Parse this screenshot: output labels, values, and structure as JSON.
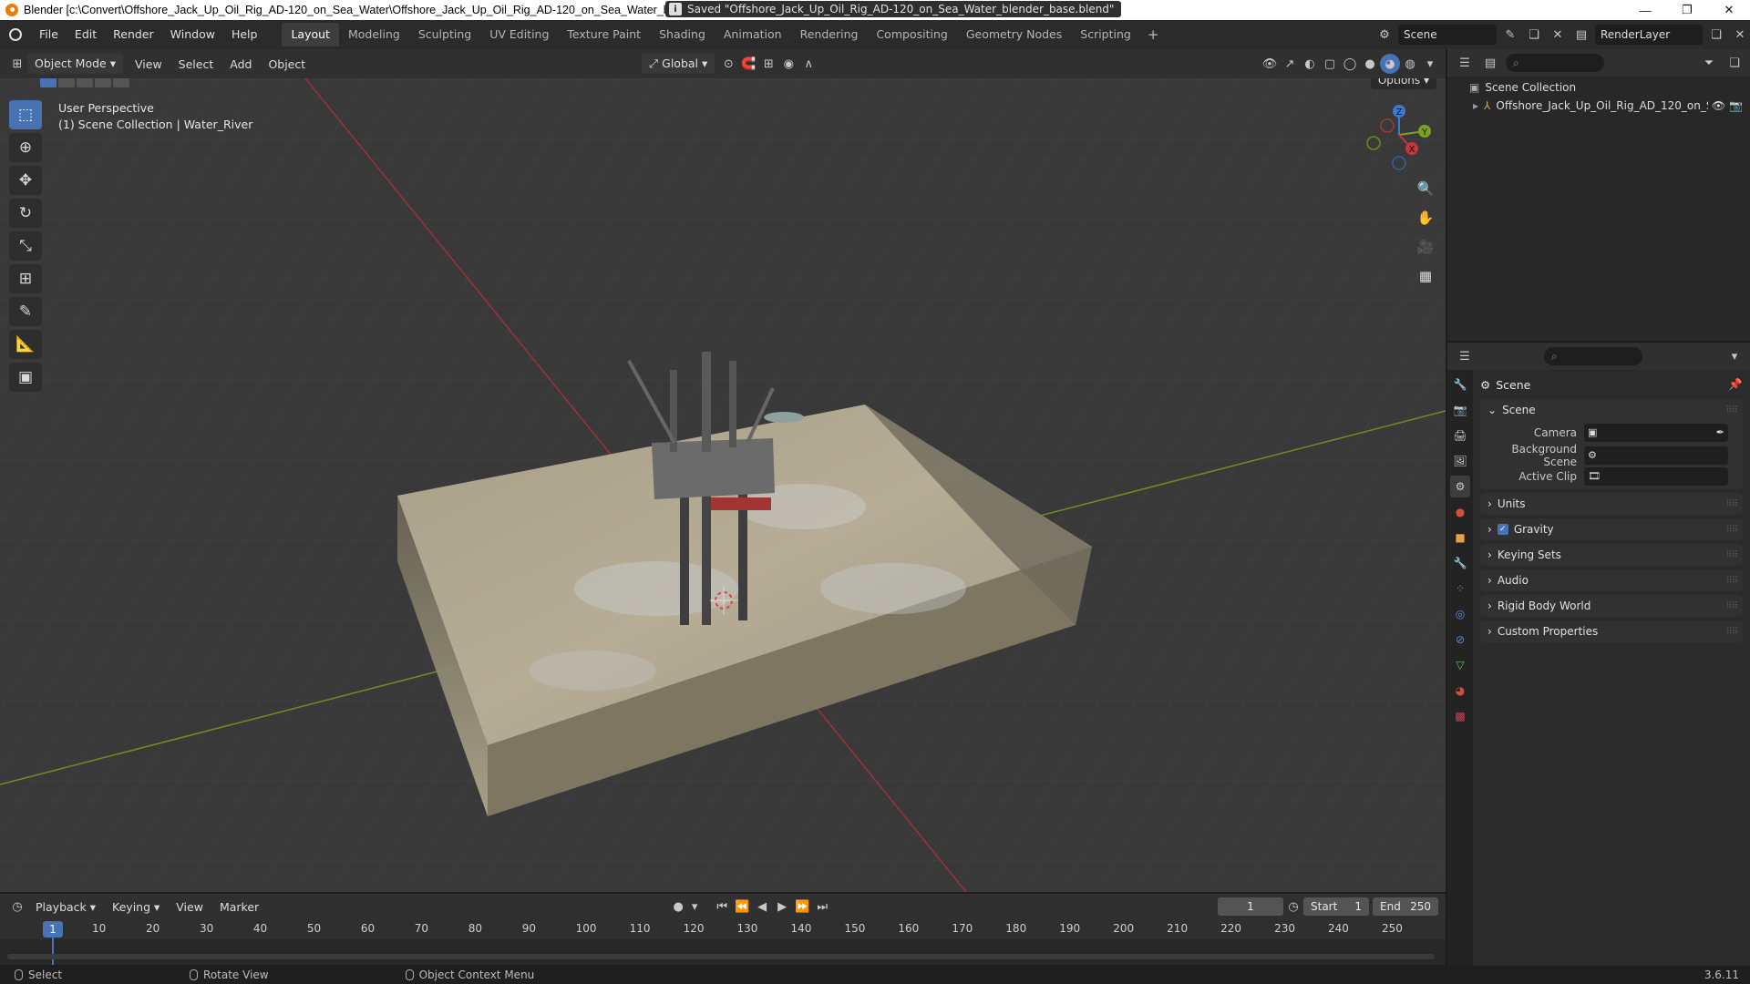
{
  "window": {
    "title": "Blender [c:\\Convert\\Offshore_Jack_Up_Oil_Rig_AD-120_on_Sea_Water\\Offshore_Jack_Up_Oil_Rig_AD-120_on_Sea_Water_blender_base.blend]",
    "minimize": "—",
    "maximize": "❐",
    "close": "✕"
  },
  "menu": {
    "items": [
      "File",
      "Edit",
      "Render",
      "Window",
      "Help"
    ],
    "workspaces": [
      "Layout",
      "Modeling",
      "Sculpting",
      "UV Editing",
      "Texture Paint",
      "Shading",
      "Animation",
      "Rendering",
      "Compositing",
      "Geometry Nodes",
      "Scripting"
    ],
    "active_workspace": "Layout",
    "add_tab": "+"
  },
  "topright": {
    "scene": "Scene",
    "render_layer": "RenderLayer"
  },
  "viewport_header": {
    "mode": "Object Mode",
    "menus": [
      "View",
      "Select",
      "Add",
      "Object"
    ],
    "transform_orientation": "Global",
    "options": "Options"
  },
  "viewport": {
    "perspective": "User Perspective",
    "collection_info": "(1) Scene Collection | Water_River",
    "gizmo": {
      "x": "X",
      "y": "Y",
      "z": "Z"
    }
  },
  "outliner": {
    "root": "Scene Collection",
    "items": [
      {
        "label": "Offshore_Jack_Up_Oil_Rig_AD_120_on_S"
      }
    ]
  },
  "properties": {
    "title": "Scene",
    "section": "Scene",
    "rows": [
      {
        "label": "Camera"
      },
      {
        "label": "Background Scene"
      },
      {
        "label": "Active Clip"
      }
    ],
    "panels": [
      "Units",
      "Gravity",
      "Keying Sets",
      "Audio",
      "Rigid Body World",
      "Custom Properties"
    ],
    "gravity_checked": true
  },
  "timeline": {
    "menus": [
      "Playback",
      "Keying",
      "View",
      "Marker"
    ],
    "current_frame": "1",
    "start_label": "Start",
    "start": "1",
    "end_label": "End",
    "end": "250",
    "ticks": [
      "1",
      "10",
      "20",
      "30",
      "40",
      "50",
      "60",
      "70",
      "80",
      "90",
      "100",
      "110",
      "120",
      "130",
      "140",
      "150",
      "160",
      "170",
      "180",
      "190",
      "200",
      "210",
      "220",
      "230",
      "240",
      "250"
    ]
  },
  "status": {
    "select": "Select",
    "rotate": "Rotate View",
    "context": "Object Context Menu",
    "message": "Saved \"Offshore_Jack_Up_Oil_Rig_AD-120_on_Sea_Water_blender_base.blend\"",
    "version": "3.6.11"
  },
  "colors": {
    "accent": "#4772b3",
    "axis_x": "#c8343d",
    "axis_y": "#7aa21f",
    "axis_z": "#3c79cf"
  }
}
